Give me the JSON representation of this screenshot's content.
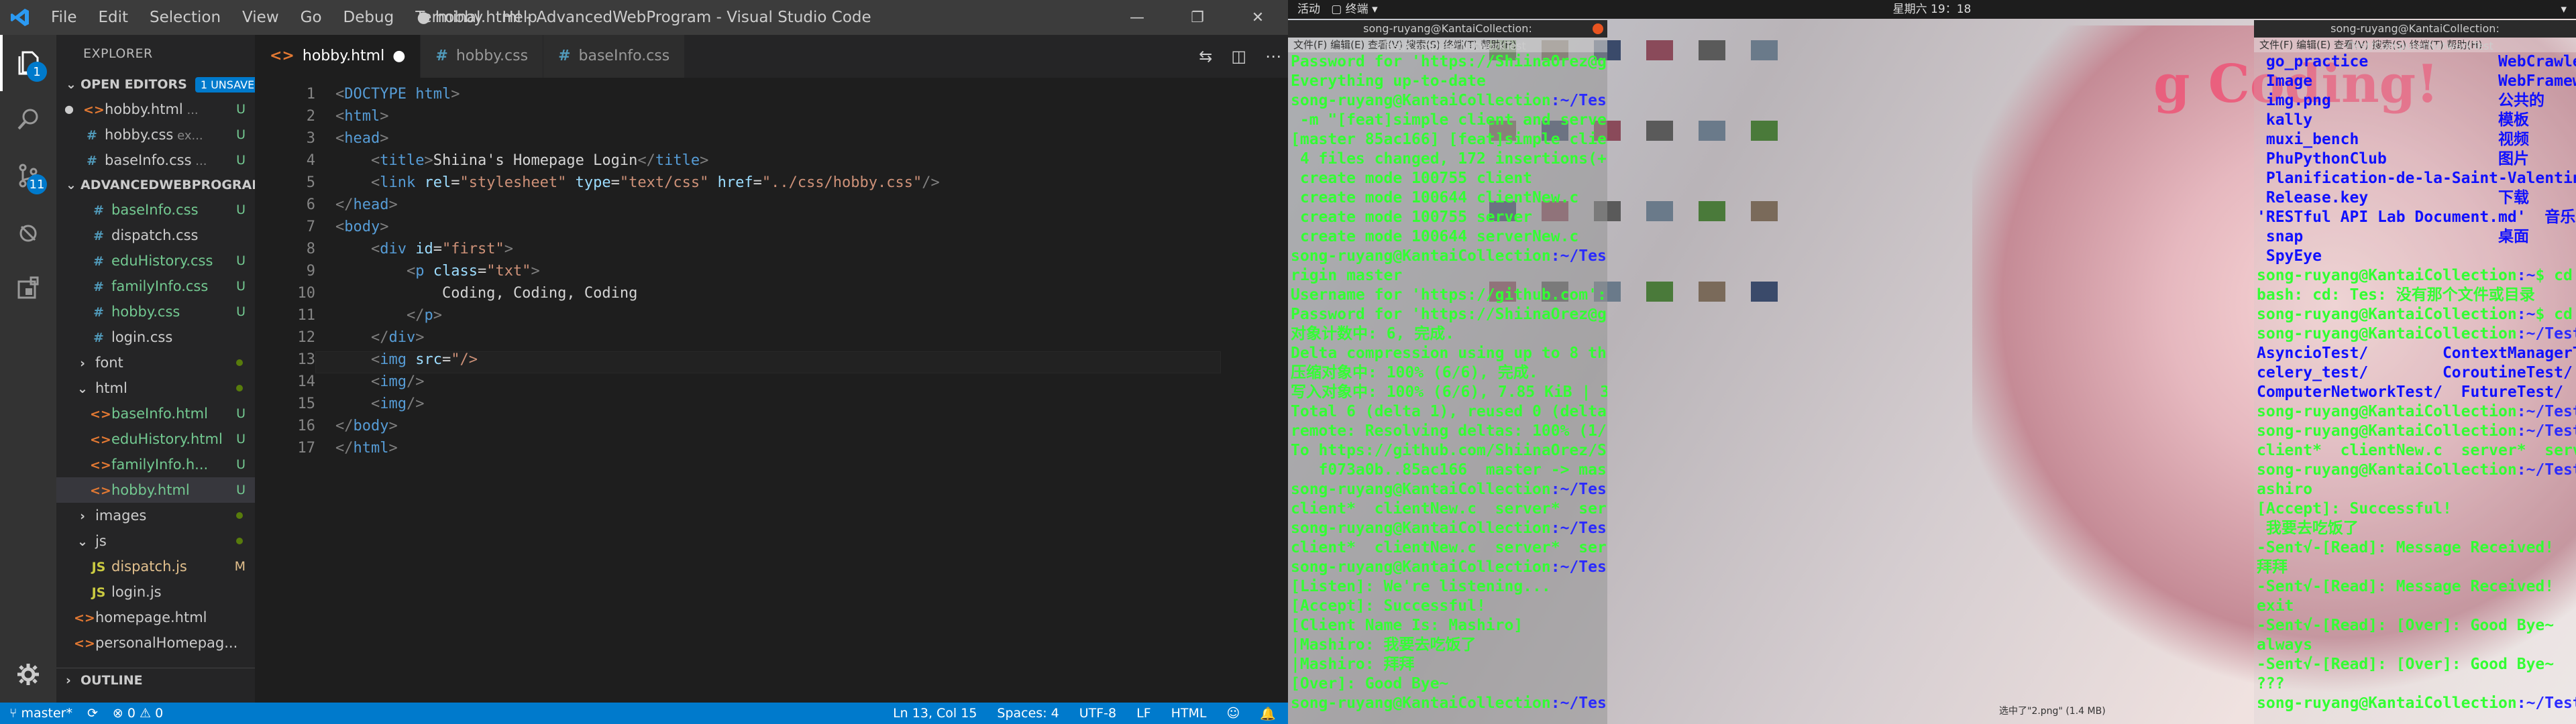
{
  "vscode": {
    "title": "● hobby.html - AdvancedWebProgram - Visual Studio Code",
    "menu": [
      "File",
      "Edit",
      "Selection",
      "View",
      "Go",
      "Debug",
      "Terminal",
      "Help"
    ],
    "window_buttons": [
      "—",
      "❐",
      "✕"
    ],
    "activity_badges": {
      "explorer": "1",
      "scm": "11"
    },
    "explorer": {
      "header": "EXPLORER",
      "open_editors": {
        "label": "OPEN EDITORS",
        "badge": "1 UNSAVED",
        "items": [
          {
            "dot": "●",
            "icon": "<>",
            "name": "hobby.html",
            "extra": "...",
            "status": "U",
            "type": "html"
          },
          {
            "icon": "#",
            "name": "hobby.css",
            "extra": "ex...",
            "status": "U",
            "type": "css"
          },
          {
            "icon": "#",
            "name": "baseInfo.css",
            "extra": "...",
            "status": "U",
            "type": "css"
          }
        ]
      },
      "project": {
        "label": "ADVANCEDWEBPROGRAM",
        "items": [
          {
            "indent": 2,
            "icon": "#",
            "name": "baseInfo.css",
            "status": "U",
            "type": "css"
          },
          {
            "indent": 2,
            "icon": "#",
            "name": "dispatch.css",
            "status": "",
            "type": "css"
          },
          {
            "indent": 2,
            "icon": "#",
            "name": "eduHistory.css",
            "status": "U",
            "type": "css"
          },
          {
            "indent": 2,
            "icon": "#",
            "name": "familyInfo.css",
            "status": "U",
            "type": "css"
          },
          {
            "indent": 2,
            "icon": "#",
            "name": "hobby.css",
            "status": "U",
            "type": "css"
          },
          {
            "indent": 2,
            "icon": "#",
            "name": "login.css",
            "status": "",
            "type": "css"
          },
          {
            "indent": 1,
            "icon": "›",
            "name": "font",
            "status": "dot",
            "type": "folder"
          },
          {
            "indent": 1,
            "icon": "⌄",
            "name": "html",
            "status": "dot",
            "type": "folder"
          },
          {
            "indent": 2,
            "icon": "<>",
            "name": "baseInfo.html",
            "status": "U",
            "type": "html"
          },
          {
            "indent": 2,
            "icon": "<>",
            "name": "eduHistory.html",
            "status": "U",
            "type": "html"
          },
          {
            "indent": 2,
            "icon": "<>",
            "name": "familyInfo.h...",
            "status": "U",
            "type": "html"
          },
          {
            "indent": 2,
            "icon": "<>",
            "name": "hobby.html",
            "status": "U",
            "type": "html",
            "selected": true
          },
          {
            "indent": 1,
            "icon": "›",
            "name": "images",
            "status": "dot",
            "type": "folder"
          },
          {
            "indent": 1,
            "icon": "⌄",
            "name": "js",
            "status": "dot",
            "type": "folder"
          },
          {
            "indent": 2,
            "icon": "JS",
            "name": "dispatch.js",
            "status": "M",
            "type": "js"
          },
          {
            "indent": 2,
            "icon": "JS",
            "name": "login.js",
            "status": "",
            "type": "js"
          },
          {
            "indent": 1,
            "icon": "<>",
            "name": "homepage.html",
            "status": "",
            "type": "html"
          },
          {
            "indent": 1,
            "icon": "<>",
            "name": "personalHomepag...",
            "status": "",
            "type": "html"
          }
        ]
      },
      "outline": "OUTLINE"
    },
    "tabs": [
      {
        "label": "hobby.html",
        "type": "html",
        "active": true,
        "dirty": "●"
      },
      {
        "label": "hobby.css",
        "type": "css"
      },
      {
        "label": "baseInfo.css",
        "type": "css"
      }
    ],
    "code_lines": [
      "<!DOCTYPE html>",
      "<html>",
      "<head>",
      "    <title>Shiina's Homepage Login</title>",
      "    <link rel=\"stylesheet\" type=\"text/css\" href=\"../css/hobby.css\"/>",
      "</head>",
      "<body>",
      "    <div id=\"first\">",
      "        <p class=\"txt\">",
      "            Coding, Coding, Coding!",
      "        </p>",
      "    </div>",
      "    <img src=\"/>",
      "    <img/>",
      "    <img/>",
      "</body>",
      "</html>"
    ],
    "status": {
      "branch": "master*",
      "sync": "⟳",
      "errors": "0",
      "warnings": "0",
      "position": "Ln 13, Col 15",
      "spaces": "Spaces: 4",
      "encoding": "UTF-8",
      "eol": "LF",
      "language": "HTML"
    }
  },
  "desktop": {
    "panel": {
      "activities": "活动",
      "app": "▢ 终端 ▾",
      "clock": "星期六 19：18",
      "indicators": "▾"
    },
    "term1_title": "song-ruyang@KantaiCollection: ~/Test/ComputerNetworkTest",
    "term3_title": "song-ruyang@KantaiCollection: ~/Test/ComputerNetworkTest",
    "term_menu": "文件(F)  编辑(E)  查看(V)  搜索(S)  终端(T)  帮助(H)",
    "wall_text": "g Coding!",
    "footer_note": "选中了\"2.png\" (1.4 MB)",
    "term1_lines": [
      {
        "t": "Password for 'https://ShiinaOrez@github.com':",
        "c": "tl"
      },
      {
        "t": "Everything up-to-date",
        "c": "tl"
      },
      {
        "p": "song-ruyang@KantaiCollection",
        "d": ":~/Test/ComputerNetworkTest",
        "r": "$ git commit"
      },
      {
        "t": " -m \"[feat]simple client and server\"",
        "c": "tl"
      },
      {
        "t": "[master 85ac166] [feat]simple client and server",
        "c": "tl"
      },
      {
        "t": " 4 files changed, 172 insertions(+)",
        "c": "tl"
      },
      {
        "t": " create mode 100755 client",
        "c": "tl"
      },
      {
        "t": " create mode 100644 clientNew.c",
        "c": "tl"
      },
      {
        "t": " create mode 100755 server",
        "c": "tl"
      },
      {
        "t": " create mode 100644 serverNew.c",
        "c": "tl"
      },
      {
        "p": "song-ruyang@KantaiCollection",
        "d": ":~/Test/ComputerNetworkTest",
        "r": "$ git push o"
      },
      {
        "t": "rigin master",
        "c": "tl"
      },
      {
        "t": "Username for 'https://github.com': ShiinaOrez",
        "c": "tl"
      },
      {
        "t": "Password for 'https://ShiinaOrez@github.com':",
        "c": "tl"
      },
      {
        "t": "对象计数中: 6, 完成.",
        "c": "tl"
      },
      {
        "t": "Delta compression using up to 8 threads.",
        "c": "tl"
      },
      {
        "t": "压缩对象中: 100% (6/6), 完成.",
        "c": "tl"
      },
      {
        "t": "写入对象中: 100% (6/6), 7.85 KiB | 3.92 MiB/s, 完成.",
        "c": "tl"
      },
      {
        "t": "Total 6 (delta 1), reused 0 (delta 0)",
        "c": "tl"
      },
      {
        "t": "remote: Resolving deltas: 100% (1/1), done.",
        "c": "tl"
      },
      {
        "t": "To https://github.com/ShiinaOrez/SocketProgramming.git",
        "c": "tl"
      },
      {
        "t": "   f073a0b..85ac166  master -> master",
        "c": "tl"
      },
      {
        "p": "song-ruyang@KantaiCollection",
        "d": ":~/Test/ComputerNetworkTest",
        "r": "$ l"
      },
      {
        "t": "client*  clientNew.c  server*  serverNew.c",
        "c": "tl"
      },
      {
        "p": "song-ruyang@KantaiCollection",
        "d": ":~/Test/ComputerNetworkTest",
        "r": "$ l"
      },
      {
        "t": "client*  clientNew.c  server*  serverNew.c",
        "c": "tl"
      },
      {
        "p": "song-ruyang@KantaiCollection",
        "d": ":~/Test/ComputerNetworkTest",
        "r": "$ ./server"
      },
      {
        "t": "[Listen]: We're listening...",
        "c": "tl"
      },
      {
        "t": "[Accept]: Successful!",
        "c": "tl"
      },
      {
        "t": "[Client Name Is: Mashiro]",
        "c": "tl"
      },
      {
        "t": "|Mashiro: 我要去吃饭了",
        "c": "tl"
      },
      {
        "t": "|Mashiro: 拜拜",
        "c": "tl"
      },
      {
        "t": "[Over]: Good Bye~",
        "c": "tl"
      },
      {
        "p": "song-ruyang@KantaiCollection",
        "d": ":~/Test/ComputerNetworkTest",
        "r": "$"
      }
    ],
    "term3_lines": [
      {
        "t": " go_practice              WebCrawler",
        "c": "blue"
      },
      {
        "t": " Image                    WebFrameworkStudy",
        "c": "blue"
      },
      {
        "t": " img.png                  公共的",
        "c": "blue"
      },
      {
        "t": " kally                    模板",
        "c": "blue"
      },
      {
        "t": " muxi_bench               视频",
        "c": "blue"
      },
      {
        "t": " PhuPythonClub            图片",
        "c": "blue"
      },
      {
        "t": " Planification-de-la-Saint-Valentin  文档",
        "c": "blue"
      },
      {
        "t": " Release.key              下载",
        "c": "blue"
      },
      {
        "t": "'RESTful API Lab Document.md'  音乐",
        "c": "blue"
      },
      {
        "t": " snap                     桌面",
        "c": "blue"
      },
      {
        "t": " SpyEye",
        "c": "blue"
      },
      {
        "p": "song-ruyang@KantaiCollection",
        "d": ":~",
        "r": "$ cd Tes"
      },
      {
        "t": "bash: cd: Tes: 没有那个文件或目录",
        "c": "tl"
      },
      {
        "p": "song-ruyang@KantaiCollection",
        "d": ":~",
        "r": "$ cd Test/"
      },
      {
        "p": "song-ruyang@KantaiCollection",
        "d": ":~/Test",
        "r": "$ l"
      },
      {
        "t": "AsyncioTest/        ContextManagerTest/  MiniTest/",
        "c": "blue"
      },
      {
        "t": "celery_test/        CoroutineTest/       Python/",
        "c": "blue"
      },
      {
        "t": "ComputerNetworkTest/  FutureTest/        PythonTest/",
        "c": "blue"
      },
      {
        "p": "song-ruyang@KantaiCollection",
        "d": ":~/Test",
        "r": "$ cd ComputerNetworkTest/"
      },
      {
        "p": "song-ruyang@KantaiCollection",
        "d": ":~/Test/ComputerNetworkTest",
        "r": "$ l"
      },
      {
        "t": "client*  clientNew.c  server*  serverNew.c",
        "c": "tl"
      },
      {
        "p": "song-ruyang@KantaiCollection",
        "d": ":~/Test/ComputerNetworkTest",
        "r": "$ ./client M"
      },
      {
        "t": "ashiro",
        "c": "tl"
      },
      {
        "t": "[Accept]: Successful!",
        "c": "tl"
      },
      {
        "t": " 我要去吃饭了",
        "c": "tl"
      },
      {
        "t": "-Sent√-[Read]: Message Received!",
        "c": "tl"
      },
      {
        "t": "拜拜",
        "c": "tl"
      },
      {
        "t": "-Sent√-[Read]: Message Received!",
        "c": "tl"
      },
      {
        "t": "exit",
        "c": "tl"
      },
      {
        "t": "-Sent√-[Read]: [Over]: Good Bye~",
        "c": "tl"
      },
      {
        "t": "always",
        "c": "tl"
      },
      {
        "t": "-Sent√-[Read]: [Over]: Good Bye~",
        "c": "tl"
      },
      {
        "t": "???",
        "c": "tl"
      },
      {
        "p": "song-ruyang@KantaiCollection",
        "d": ":~/Test/ComputerNetworkTest",
        "r": "$ ▮"
      }
    ],
    "colors": {
      "prompt": "#33ff33",
      "path": "#2a2aff",
      "accent": "#007acc"
    }
  }
}
